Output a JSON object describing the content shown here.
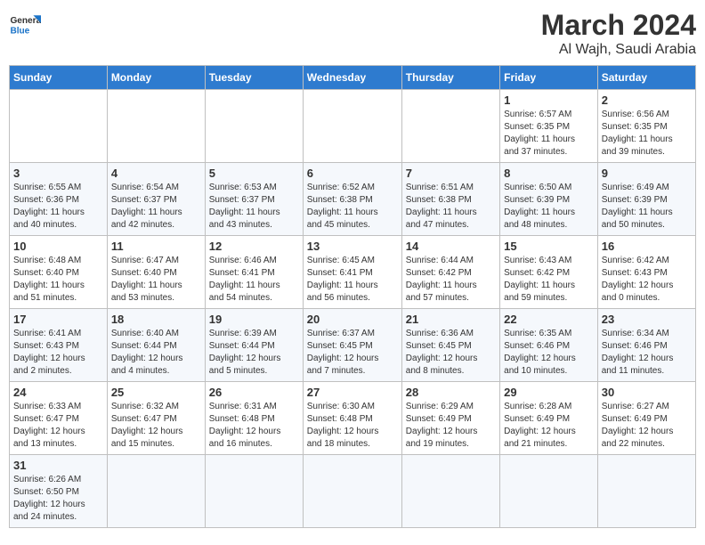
{
  "header": {
    "logo_general": "General",
    "logo_blue": "Blue",
    "month_year": "March 2024",
    "location": "Al Wajh, Saudi Arabia"
  },
  "days_of_week": [
    "Sunday",
    "Monday",
    "Tuesday",
    "Wednesday",
    "Thursday",
    "Friday",
    "Saturday"
  ],
  "weeks": [
    {
      "days": [
        {
          "number": "",
          "info": "",
          "empty": true
        },
        {
          "number": "",
          "info": "",
          "empty": true
        },
        {
          "number": "",
          "info": "",
          "empty": true
        },
        {
          "number": "",
          "info": "",
          "empty": true
        },
        {
          "number": "",
          "info": "",
          "empty": true
        },
        {
          "number": "1",
          "info": "Sunrise: 6:57 AM\nSunset: 6:35 PM\nDaylight: 11 hours\nand 37 minutes."
        },
        {
          "number": "2",
          "info": "Sunrise: 6:56 AM\nSunset: 6:35 PM\nDaylight: 11 hours\nand 39 minutes."
        }
      ]
    },
    {
      "days": [
        {
          "number": "3",
          "info": "Sunrise: 6:55 AM\nSunset: 6:36 PM\nDaylight: 11 hours\nand 40 minutes."
        },
        {
          "number": "4",
          "info": "Sunrise: 6:54 AM\nSunset: 6:37 PM\nDaylight: 11 hours\nand 42 minutes."
        },
        {
          "number": "5",
          "info": "Sunrise: 6:53 AM\nSunset: 6:37 PM\nDaylight: 11 hours\nand 43 minutes."
        },
        {
          "number": "6",
          "info": "Sunrise: 6:52 AM\nSunset: 6:38 PM\nDaylight: 11 hours\nand 45 minutes."
        },
        {
          "number": "7",
          "info": "Sunrise: 6:51 AM\nSunset: 6:38 PM\nDaylight: 11 hours\nand 47 minutes."
        },
        {
          "number": "8",
          "info": "Sunrise: 6:50 AM\nSunset: 6:39 PM\nDaylight: 11 hours\nand 48 minutes."
        },
        {
          "number": "9",
          "info": "Sunrise: 6:49 AM\nSunset: 6:39 PM\nDaylight: 11 hours\nand 50 minutes."
        }
      ]
    },
    {
      "days": [
        {
          "number": "10",
          "info": "Sunrise: 6:48 AM\nSunset: 6:40 PM\nDaylight: 11 hours\nand 51 minutes."
        },
        {
          "number": "11",
          "info": "Sunrise: 6:47 AM\nSunset: 6:40 PM\nDaylight: 11 hours\nand 53 minutes."
        },
        {
          "number": "12",
          "info": "Sunrise: 6:46 AM\nSunset: 6:41 PM\nDaylight: 11 hours\nand 54 minutes."
        },
        {
          "number": "13",
          "info": "Sunrise: 6:45 AM\nSunset: 6:41 PM\nDaylight: 11 hours\nand 56 minutes."
        },
        {
          "number": "14",
          "info": "Sunrise: 6:44 AM\nSunset: 6:42 PM\nDaylight: 11 hours\nand 57 minutes."
        },
        {
          "number": "15",
          "info": "Sunrise: 6:43 AM\nSunset: 6:42 PM\nDaylight: 11 hours\nand 59 minutes."
        },
        {
          "number": "16",
          "info": "Sunrise: 6:42 AM\nSunset: 6:43 PM\nDaylight: 12 hours\nand 0 minutes."
        }
      ]
    },
    {
      "days": [
        {
          "number": "17",
          "info": "Sunrise: 6:41 AM\nSunset: 6:43 PM\nDaylight: 12 hours\nand 2 minutes."
        },
        {
          "number": "18",
          "info": "Sunrise: 6:40 AM\nSunset: 6:44 PM\nDaylight: 12 hours\nand 4 minutes."
        },
        {
          "number": "19",
          "info": "Sunrise: 6:39 AM\nSunset: 6:44 PM\nDaylight: 12 hours\nand 5 minutes."
        },
        {
          "number": "20",
          "info": "Sunrise: 6:37 AM\nSunset: 6:45 PM\nDaylight: 12 hours\nand 7 minutes."
        },
        {
          "number": "21",
          "info": "Sunrise: 6:36 AM\nSunset: 6:45 PM\nDaylight: 12 hours\nand 8 minutes."
        },
        {
          "number": "22",
          "info": "Sunrise: 6:35 AM\nSunset: 6:46 PM\nDaylight: 12 hours\nand 10 minutes."
        },
        {
          "number": "23",
          "info": "Sunrise: 6:34 AM\nSunset: 6:46 PM\nDaylight: 12 hours\nand 11 minutes."
        }
      ]
    },
    {
      "days": [
        {
          "number": "24",
          "info": "Sunrise: 6:33 AM\nSunset: 6:47 PM\nDaylight: 12 hours\nand 13 minutes."
        },
        {
          "number": "25",
          "info": "Sunrise: 6:32 AM\nSunset: 6:47 PM\nDaylight: 12 hours\nand 15 minutes."
        },
        {
          "number": "26",
          "info": "Sunrise: 6:31 AM\nSunset: 6:48 PM\nDaylight: 12 hours\nand 16 minutes."
        },
        {
          "number": "27",
          "info": "Sunrise: 6:30 AM\nSunset: 6:48 PM\nDaylight: 12 hours\nand 18 minutes."
        },
        {
          "number": "28",
          "info": "Sunrise: 6:29 AM\nSunset: 6:49 PM\nDaylight: 12 hours\nand 19 minutes."
        },
        {
          "number": "29",
          "info": "Sunrise: 6:28 AM\nSunset: 6:49 PM\nDaylight: 12 hours\nand 21 minutes."
        },
        {
          "number": "30",
          "info": "Sunrise: 6:27 AM\nSunset: 6:49 PM\nDaylight: 12 hours\nand 22 minutes."
        }
      ]
    },
    {
      "days": [
        {
          "number": "31",
          "info": "Sunrise: 6:26 AM\nSunset: 6:50 PM\nDaylight: 12 hours\nand 24 minutes."
        },
        {
          "number": "",
          "info": "",
          "empty": true
        },
        {
          "number": "",
          "info": "",
          "empty": true
        },
        {
          "number": "",
          "info": "",
          "empty": true
        },
        {
          "number": "",
          "info": "",
          "empty": true
        },
        {
          "number": "",
          "info": "",
          "empty": true
        },
        {
          "number": "",
          "info": "",
          "empty": true
        }
      ]
    }
  ]
}
